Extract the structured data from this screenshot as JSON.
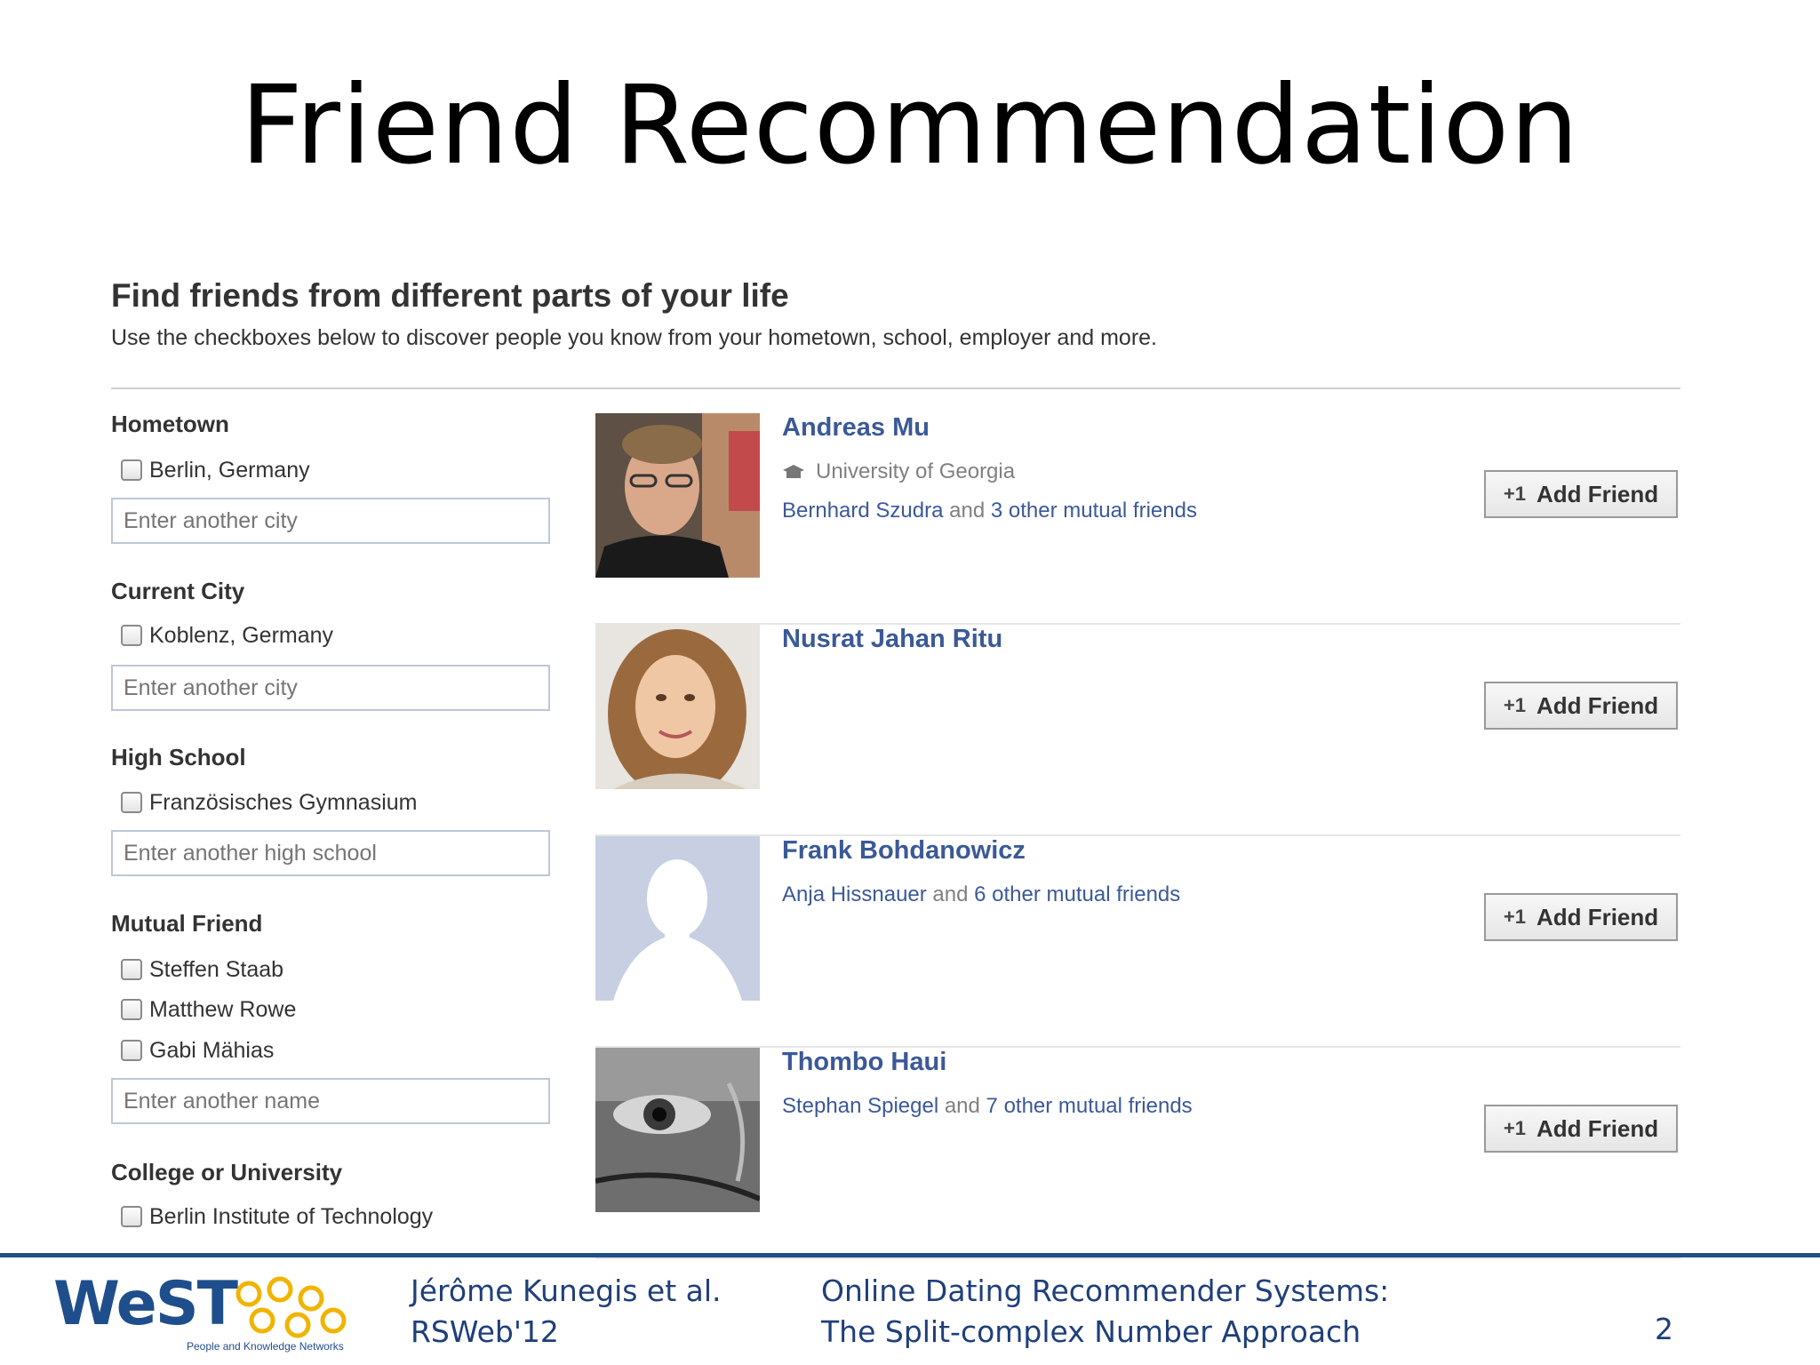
{
  "slide": {
    "title": "Friend Recommendation"
  },
  "panel": {
    "heading": "Find friends from different parts of your life",
    "subheading": "Use the checkboxes below to discover people you know from your hometown, school, employer and more."
  },
  "filters": {
    "hometown": {
      "title": "Hometown",
      "options": [
        "Berlin, Germany"
      ],
      "placeholder": "Enter another city"
    },
    "current_city": {
      "title": "Current City",
      "options": [
        "Koblenz, Germany"
      ],
      "placeholder": "Enter another city"
    },
    "high_school": {
      "title": "High School",
      "options": [
        "Französisches Gymnasium"
      ],
      "placeholder": "Enter another high school"
    },
    "mutual_friend": {
      "title": "Mutual Friend",
      "options": [
        "Steffen Staab",
        "Matthew Rowe",
        "Gabi Mähias"
      ],
      "placeholder": "Enter another name"
    },
    "college": {
      "title": "College or University",
      "options": [
        "Berlin Institute of Technology"
      ]
    }
  },
  "people": [
    {
      "name": "Andreas Mu",
      "school": "University of Georgia",
      "mutual_name": "Bernhard Szudra",
      "mutual_and": "and",
      "mutual_rest": "3 other mutual friends",
      "button": "Add Friend"
    },
    {
      "name": "Nusrat Jahan Ritu",
      "button": "Add Friend"
    },
    {
      "name": "Frank Bohdanowicz",
      "mutual_name": "Anja Hissnauer",
      "mutual_and": "and",
      "mutual_rest": "6 other mutual friends",
      "button": "Add Friend"
    },
    {
      "name": "Thombo Haui",
      "mutual_name": "Stephan Spiegel",
      "mutual_and": "and",
      "mutual_rest": "7 other mutual friends",
      "button": "Add Friend"
    }
  ],
  "button_icon": "+1",
  "footer": {
    "logo": "WeST",
    "logo_tagline": "People and Knowledge Networks",
    "author": "Jérôme Kunegis et al.",
    "venue": "RSWeb'12",
    "talk_line1": "Online Dating Recommender Systems:",
    "talk_line2": "The Split-complex Number Approach",
    "page": "2"
  }
}
